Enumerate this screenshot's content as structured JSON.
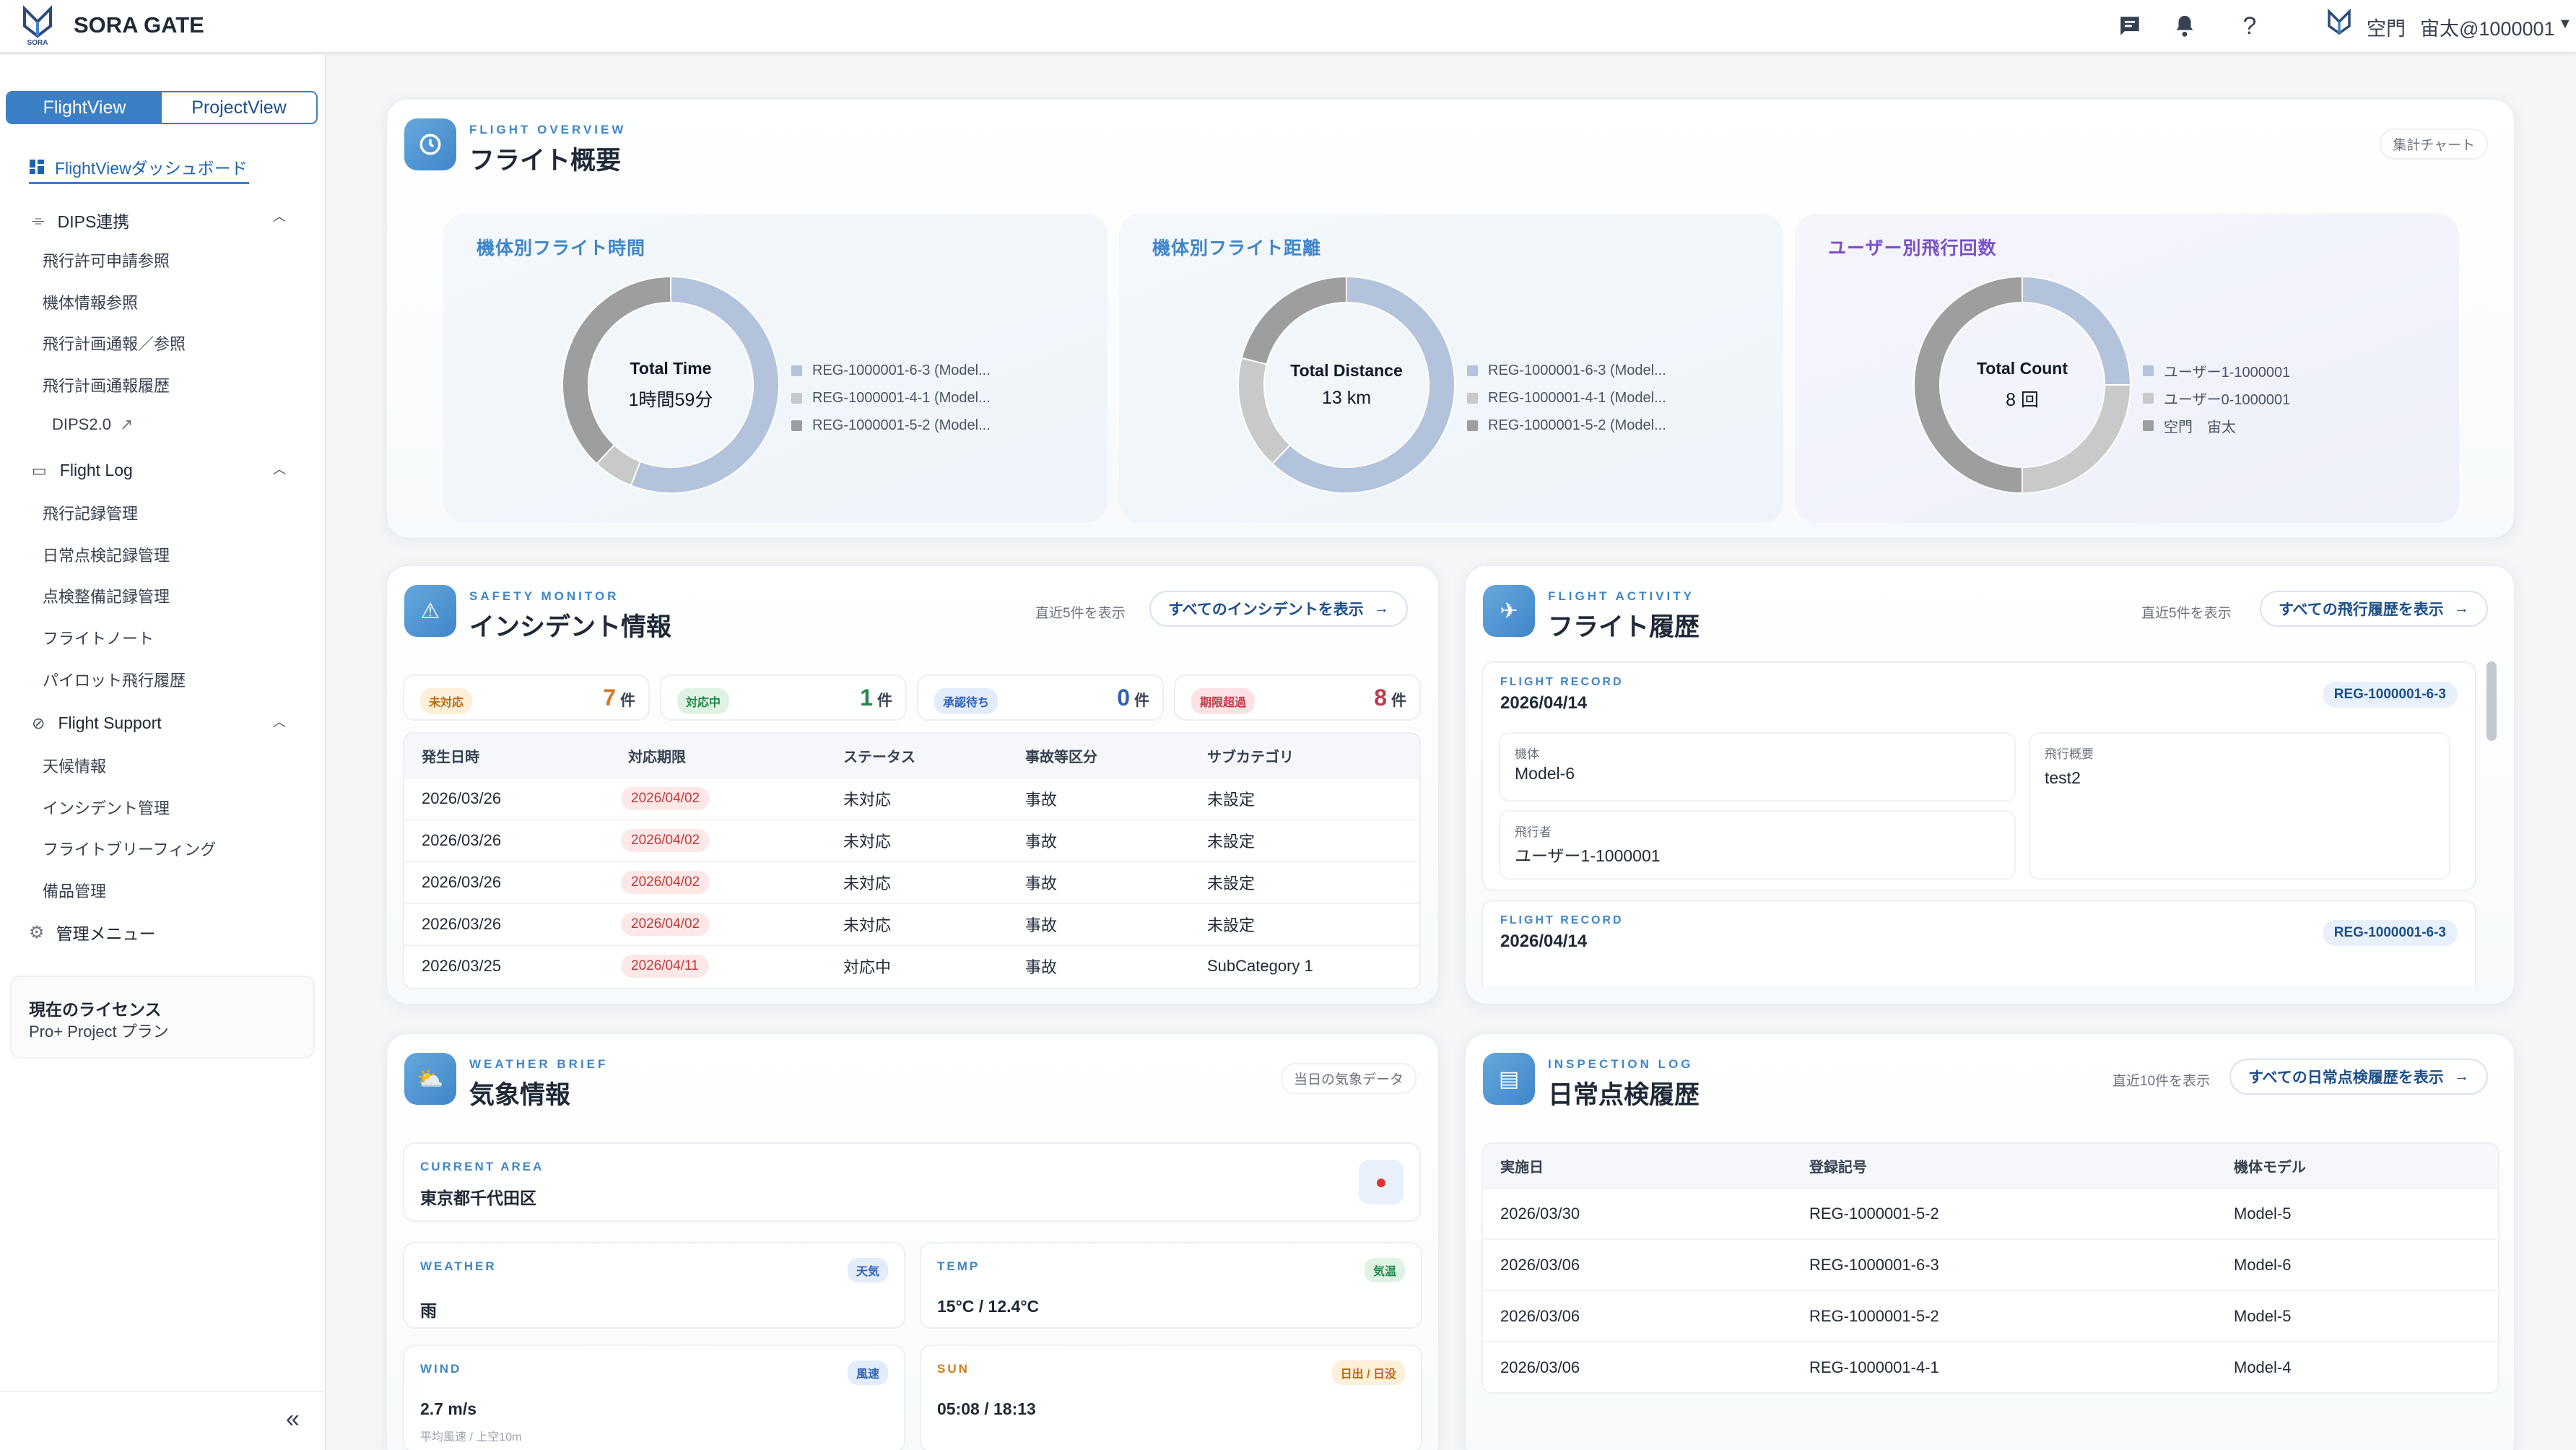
{
  "app": {
    "name": "SORA GATE",
    "logo_text": "SORA",
    "user_name": "空門",
    "user_id": "宙太@1000001"
  },
  "sidebar": {
    "tabs": [
      "FlightView",
      "ProjectView"
    ],
    "dashboard": "FlightViewダッシュボード",
    "groups": [
      {
        "label": "DIPS連携",
        "items": [
          "飛行許可申請参照",
          "機体情報参照",
          "飛行計画通報／参照",
          "飛行計画通報履歴",
          "DIPS2.0"
        ]
      },
      {
        "label": "Flight Log",
        "items": [
          "飛行記録管理",
          "日常点検記録管理",
          "点検整備記録管理",
          "フライトノート",
          "パイロット飛行履歴"
        ]
      },
      {
        "label": "Flight Support",
        "items": [
          "天候情報",
          "インシデント管理",
          "フライトブリーフィング",
          "備品管理"
        ]
      }
    ],
    "admin": "管理メニュー",
    "license_title": "現在のライセンス",
    "license_value": "Pro+ Project プラン"
  },
  "overview": {
    "eyebrow": "FLIGHT OVERVIEW",
    "title": "フライト概要",
    "tag": "集計チャート",
    "charts": [
      {
        "title": "機体別フライト時間",
        "center_label": "Total Time",
        "center_value": "1時間59分",
        "legend": [
          "REG-1000001-6-3 (Model...",
          "REG-1000001-4-1 (Model...",
          "REG-1000001-5-2 (Model..."
        ],
        "values": [
          56,
          6,
          38
        ]
      },
      {
        "title": "機体別フライト距離",
        "center_label": "Total Distance",
        "center_value": "13 km",
        "legend": [
          "REG-1000001-6-3 (Model...",
          "REG-1000001-4-1 (Model...",
          "REG-1000001-5-2 (Model..."
        ],
        "values": [
          62,
          17,
          21
        ]
      },
      {
        "title": "ユーザー別飛行回数",
        "center_label": "Total Count",
        "center_value": "8 回",
        "legend": [
          "ユーザー1-1000001",
          "ユーザー0-1000001",
          "空門　宙太"
        ],
        "values": [
          25,
          25,
          50
        ]
      }
    ],
    "colors": [
      "#b3c3dc",
      "#c9c9c9",
      "#9e9e9e"
    ]
  },
  "incident": {
    "eyebrow": "SAFETY MONITOR",
    "title": "インシデント情報",
    "tag": "直近5件を表示",
    "link": "すべてのインシデントを表示",
    "stats": [
      {
        "label": "未対応",
        "count": "7",
        "unit": "件"
      },
      {
        "label": "対応中",
        "count": "1",
        "unit": "件"
      },
      {
        "label": "承認待ち",
        "count": "0",
        "unit": "件"
      },
      {
        "label": "期限超過",
        "count": "8",
        "unit": "件"
      }
    ],
    "headers": [
      "発生日時",
      "対応期限",
      "ステータス",
      "事故等区分",
      "サブカテゴリ"
    ],
    "rows": [
      [
        "2026/03/26",
        "2026/04/02",
        "未対応",
        "事故",
        "未設定"
      ],
      [
        "2026/03/26",
        "2026/04/02",
        "未対応",
        "事故",
        "未設定"
      ],
      [
        "2026/03/26",
        "2026/04/02",
        "未対応",
        "事故",
        "未設定"
      ],
      [
        "2026/03/26",
        "2026/04/02",
        "未対応",
        "事故",
        "未設定"
      ],
      [
        "2026/03/25",
        "2026/04/11",
        "対応中",
        "事故",
        "SubCategory 1"
      ]
    ]
  },
  "flight_history": {
    "eyebrow": "FLIGHT ACTIVITY",
    "title": "フライト履歴",
    "tag": "直近5件を表示",
    "link": "すべての飛行履歴を表示",
    "records": [
      {
        "label": "FLIGHT RECORD",
        "date": "2026/04/14",
        "reg": "REG-1000001-6-3",
        "aircraft_label": "機体",
        "aircraft": "Model-6",
        "summary_label": "飛行概要",
        "summary": "test2",
        "pilot_label": "飛行者",
        "pilot": "ユーザー1-1000001"
      },
      {
        "label": "FLIGHT RECORD",
        "date": "2026/04/14",
        "reg": "REG-1000001-6-3"
      }
    ]
  },
  "weather": {
    "eyebrow": "WEATHER BRIEF",
    "title": "気象情報",
    "tag": "当日の気象データ",
    "area_label": "CURRENT AREA",
    "area": "東京都千代田区",
    "cards": [
      {
        "key": "WEATHER",
        "chip": "天気",
        "value": "雨",
        "sub": ""
      },
      {
        "key": "TEMP",
        "chip": "気温",
        "value": "15°C / 12.4°C",
        "sub": ""
      },
      {
        "key": "WIND",
        "chip": "風速",
        "value": "2.7 m/s",
        "sub": "平均風速 / 上空10m"
      },
      {
        "key": "SUN",
        "chip": "日出 / 日没",
        "value": "05:08 / 18:13",
        "sub": ""
      }
    ]
  },
  "inspection": {
    "eyebrow": "INSPECTION LOG",
    "title": "日常点検履歴",
    "tag": "直近10件を表示",
    "link": "すべての日常点検履歴を表示",
    "headers": [
      "実施日",
      "登録記号",
      "機体モデル"
    ],
    "rows": [
      [
        "2026/03/30",
        "REG-1000001-5-2",
        "Model-5"
      ],
      [
        "2026/03/06",
        "REG-1000001-6-3",
        "Model-6"
      ],
      [
        "2026/03/06",
        "REG-1000001-5-2",
        "Model-5"
      ],
      [
        "2026/03/06",
        "REG-1000001-4-1",
        "Model-4"
      ]
    ]
  }
}
